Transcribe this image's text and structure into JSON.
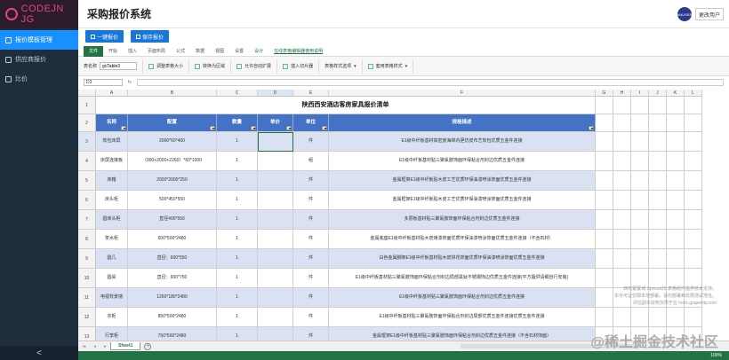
{
  "app": {
    "logo_text": "CODEJN JG",
    "title": "采购报价系统"
  },
  "sidebar": {
    "items": [
      {
        "label": "报价模板管理",
        "active": true
      },
      {
        "label": "供应商报价",
        "active": false
      },
      {
        "label": "比价",
        "active": false
      }
    ],
    "collapse_label": "<"
  },
  "header": {
    "avatar_text": "ANUSER",
    "user_button": "更改用户"
  },
  "toolbar": {
    "buttons": [
      "一键报价",
      "保存报价"
    ]
  },
  "ribbon": {
    "tabs": [
      "文件",
      "开始",
      "插入",
      "页面布局",
      "公式",
      "数据",
      "视图",
      "设置",
      "设计",
      "在线表格编辑器使用说明"
    ],
    "sheet_name_label": "表名称",
    "sheet_name_value": "gcTable3",
    "items": [
      "调整表格大小",
      "转换为区域",
      "允许自动扩展",
      "插入切片器",
      "表格样式选项",
      "套用表格样式"
    ]
  },
  "formula": {
    "namebox": "D3",
    "fx": "fx"
  },
  "sheet": {
    "columns": [
      "A",
      "B",
      "C",
      "D",
      "E",
      "F",
      "G",
      "H",
      "I",
      "J",
      "K",
      "L"
    ],
    "title": "陕西西安酒店客房家具报价清单",
    "headers": [
      "名称",
      "配置",
      "数量",
      "单价",
      "单位",
      "规格描述"
    ],
    "rows": [
      {
        "num": "3",
        "cells": [
          "软包床屏",
          "2000*60*400",
          "1",
          "",
          "件",
          "E1级中纤板基材高密度海绵内胆仿皮布艺软包优质五金件连接"
        ]
      },
      {
        "num": "4",
        "cells": [
          "床屏连接板",
          "（900+2000+2260）*60*1000",
          "1",
          "",
          "组",
          "E1级中纤板基材贴三聚氰胺饰面环保粘合剂封边优质五金件连接"
        ]
      },
      {
        "num": "5",
        "cells": [
          "床箱",
          "2000*2000*250",
          "1",
          "",
          "件",
          "金属框架E1级中纤板贴木皮工艺优质环保油漆喷涂饰面优质五金件连接"
        ]
      },
      {
        "num": "6",
        "cells": [
          "床头柜",
          "500*450*550",
          "1",
          "",
          "件",
          "金属框架E1级中纤板贴木皮工艺优质环保油漆喷涂饰面优质五金件连接"
        ]
      },
      {
        "num": "7",
        "cells": [
          "圆床头柜",
          "直径400*550",
          "1",
          "",
          "件",
          "多层板基材贴三聚氰胺饰面环保粘合剂封边优质五金件连接"
        ]
      },
      {
        "num": "8",
        "cells": [
          "茶水柜",
          "600*500*2480",
          "1",
          "",
          "件",
          "金属底座E1级中纤板基材贴木皮烤漆饰面优质环保油漆喷涂饰面优质五金件连接（不含石材）"
        ]
      },
      {
        "num": "9",
        "cells": [
          "圆几",
          "直径：600*550",
          "1",
          "",
          "件",
          "白色金属脚架E1级中纤板基材贴木皮拼花饰面优质环保油漆喷涂饰面优质五金件连接"
        ]
      },
      {
        "num": "10",
        "cells": [
          "圆桌",
          "直径：900*750",
          "1",
          "",
          "件",
          "E1级中纤板基材贴三聚氰胺饰面环保粘合剂封边局部黑钛不锈钢饰边优质五金件连接(平方擅供请细自行安装)"
        ]
      },
      {
        "num": "11",
        "cells": [
          "电视背景墙",
          "1260*180*2480",
          "1",
          "",
          "件",
          "E1级中纤板基材贴三聚氰胺饰面环保粘合剂封边优质五金件连接"
        ]
      },
      {
        "num": "12",
        "cells": [
          "衣柜",
          "850*500*2480",
          "1",
          "",
          "件",
          "E1级中纤板基材贴三聚氰胺饰面环保粘合剂封边局部优质五金件连接优质五金件连接"
        ]
      },
      {
        "num": "13",
        "cells": [
          "行李柜",
          "750*500*2480",
          "1",
          "",
          "件",
          "金属框架E1级中纤板基材贴三聚氰胺饰面环保粘合剂封边优质五金件连接（不含石材饰面）"
        ]
      }
    ]
  },
  "bottom": {
    "sheet_tab": "Sheet1",
    "add_sheet": "+",
    "zoom": "100%"
  },
  "watermark": {
    "lines": [
      "西安蒙蒙城 SpreadJS 表格组件提供技术支持。",
      "本许可证仅限本地部署。请勿部署到仅限测试地址。",
      "评估副本授权仅限于在 tools.grapecity.com"
    ],
    "brand": "@稀土掘金技术社区"
  },
  "colors": {
    "sidebar_bg": "#1f2d3d",
    "accent": "#1890ff",
    "excel_green": "#217346",
    "table_header": "#4472c4",
    "table_band": "#d9e1f2"
  }
}
